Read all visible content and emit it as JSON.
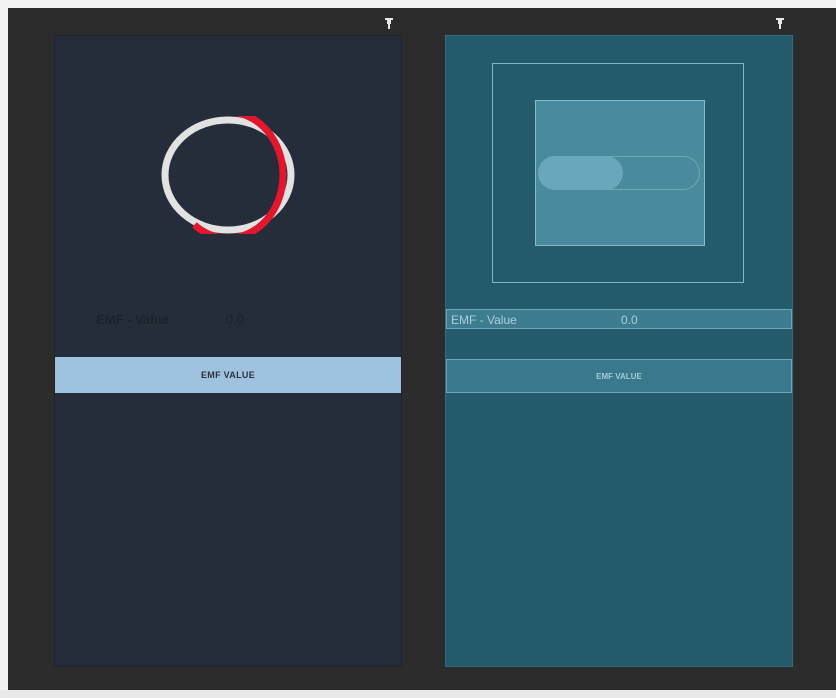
{
  "design": {
    "emf_label": "EMF - Value",
    "emf_value": "0.0",
    "button_label": "EMF VALUE"
  },
  "blueprint": {
    "emf_label": "EMF - Value",
    "emf_value": "0.0",
    "button_label": "EMF VALUE"
  },
  "progress": {
    "fraction": 0.6,
    "track_color": "#e2e2e2",
    "fill_color": "#e2162c"
  },
  "colors": {
    "design_background": "#252d3a",
    "design_button": "#9fc3de",
    "blueprint_background": "#235b6c",
    "workspace": "#2c2c2c"
  },
  "icons": {
    "pin": "pin-icon"
  }
}
